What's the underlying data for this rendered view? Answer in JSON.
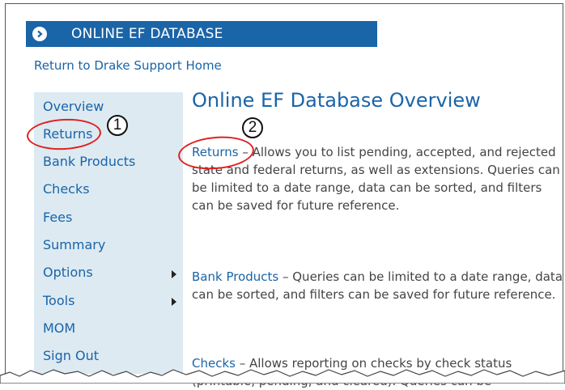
{
  "header": {
    "title": "ONLINE EF DATABASE",
    "icon": "chevron-right-circle-icon",
    "bar_color": "#1a64a8"
  },
  "return_link": "Return to Drake Support Home",
  "sidebar": {
    "background": "#ddeaf2",
    "items": [
      {
        "label": "Overview"
      },
      {
        "label": "Returns"
      },
      {
        "label": "Bank Products"
      },
      {
        "label": "Checks"
      },
      {
        "label": "Fees"
      },
      {
        "label": "Summary"
      },
      {
        "label": "Options",
        "has_submenu": true
      },
      {
        "label": "Tools",
        "has_submenu": true
      },
      {
        "label": "MOM"
      },
      {
        "label": "Sign Out"
      }
    ]
  },
  "main": {
    "title": "Online EF Database Overview",
    "sections": [
      {
        "term": "Returns",
        "text": " – Allows you to list pending, accepted, and rejected state and federal returns, as well as extensions.  Queries can be limited to a date range, data can be sorted, and filters can be saved for future reference."
      },
      {
        "term": "Bank Products",
        "text": " – Queries can be limited to a date range, data can be sorted, and filters can be saved for future reference."
      },
      {
        "term": "Checks",
        "text": " – Allows reporting on checks by check status (printable, pending, and cleared). Queries can be"
      }
    ]
  },
  "callouts": [
    {
      "number": "1"
    },
    {
      "number": "2"
    }
  ],
  "colors": {
    "link": "#1a64a8",
    "callout": "#e02020"
  }
}
